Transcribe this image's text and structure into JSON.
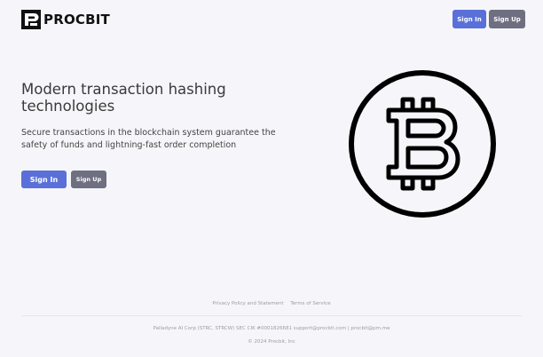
{
  "brand": {
    "name": "PROCBIT",
    "logo_icon": "procbit-logo-icon"
  },
  "header": {
    "signin_label": "Sign In",
    "signup_label": "Sign Up"
  },
  "hero": {
    "title": "Modern transaction hashing technologies",
    "subtitle": "Secure transactions in the blockchain system guarantee the safety of funds and lightning-fast order completion",
    "signin_label": "Sign In",
    "signup_label": "Sign Up",
    "illustration_icon": "bitcoin-icon"
  },
  "footer": {
    "links": [
      "Privacy Policy and Statement",
      "Terms of Service"
    ],
    "info": "Palladyne AI Corp (STRC, STRCW) SEC CIK #0001826681 support@procbit.com | procbit@pm.me",
    "copyright": "© 2024 Procbit, Inc"
  },
  "colors": {
    "background": "#f6f6fa",
    "primary": "#5a70d8",
    "secondary": "#6e6f80",
    "text": "#3a3a3a"
  }
}
